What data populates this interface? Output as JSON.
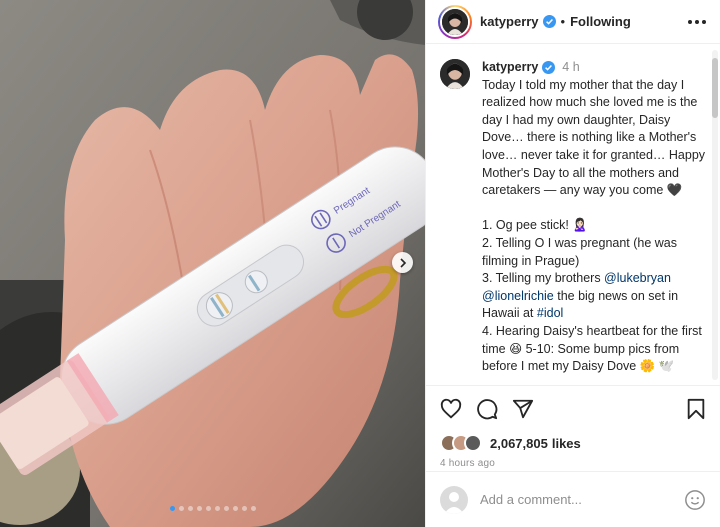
{
  "post": {
    "image_alt": "Hand holding a pregnancy test",
    "test_labels": {
      "pregnant": "Pregnant",
      "not_pregnant": "Not Pregnant"
    },
    "carousel": {
      "total": 10,
      "active": 1
    }
  },
  "header": {
    "username": "katyperry",
    "separator": "•",
    "follow_state": "Following"
  },
  "caption": {
    "username": "katyperry",
    "time": "4 h",
    "text_intro": "Today I told my mother that the day I realized how much she loved me is the day I had my own daughter, Daisy Dove… there is nothing like a Mother's love… never take it for granted… Happy Mother's Day to all the mothers and caretakers — any way you come 🖤",
    "item1": "1. Og pee stick! 🙎🏻‍♀️",
    "item2": "2. Telling O I was pregnant (he was filming in Prague)",
    "item3_pre": "3. Telling my brothers ",
    "mention1": "@lukebryan",
    "mention2": "@lionelrichie",
    "item3_post": " the big news on set in Hawaii at ",
    "mention3": "#idol",
    "item4": "4. Hearing Daisy's heartbeat for the first time 😆 5-10: Some bump pics from before I met my Daisy Dove 🌼 🕊️"
  },
  "actions": {
    "like_icon": "heart-icon",
    "comment_icon": "comment-icon",
    "share_icon": "share-icon",
    "save_icon": "bookmark-icon"
  },
  "likes": {
    "count": "2,067,805",
    "label": "likes"
  },
  "timestamp": "4 hours ago",
  "comment": {
    "placeholder": "Add a comment..."
  },
  "colors": {
    "verified": "#3897f0",
    "mention": "#00376b",
    "muted": "#8e8e8e"
  }
}
